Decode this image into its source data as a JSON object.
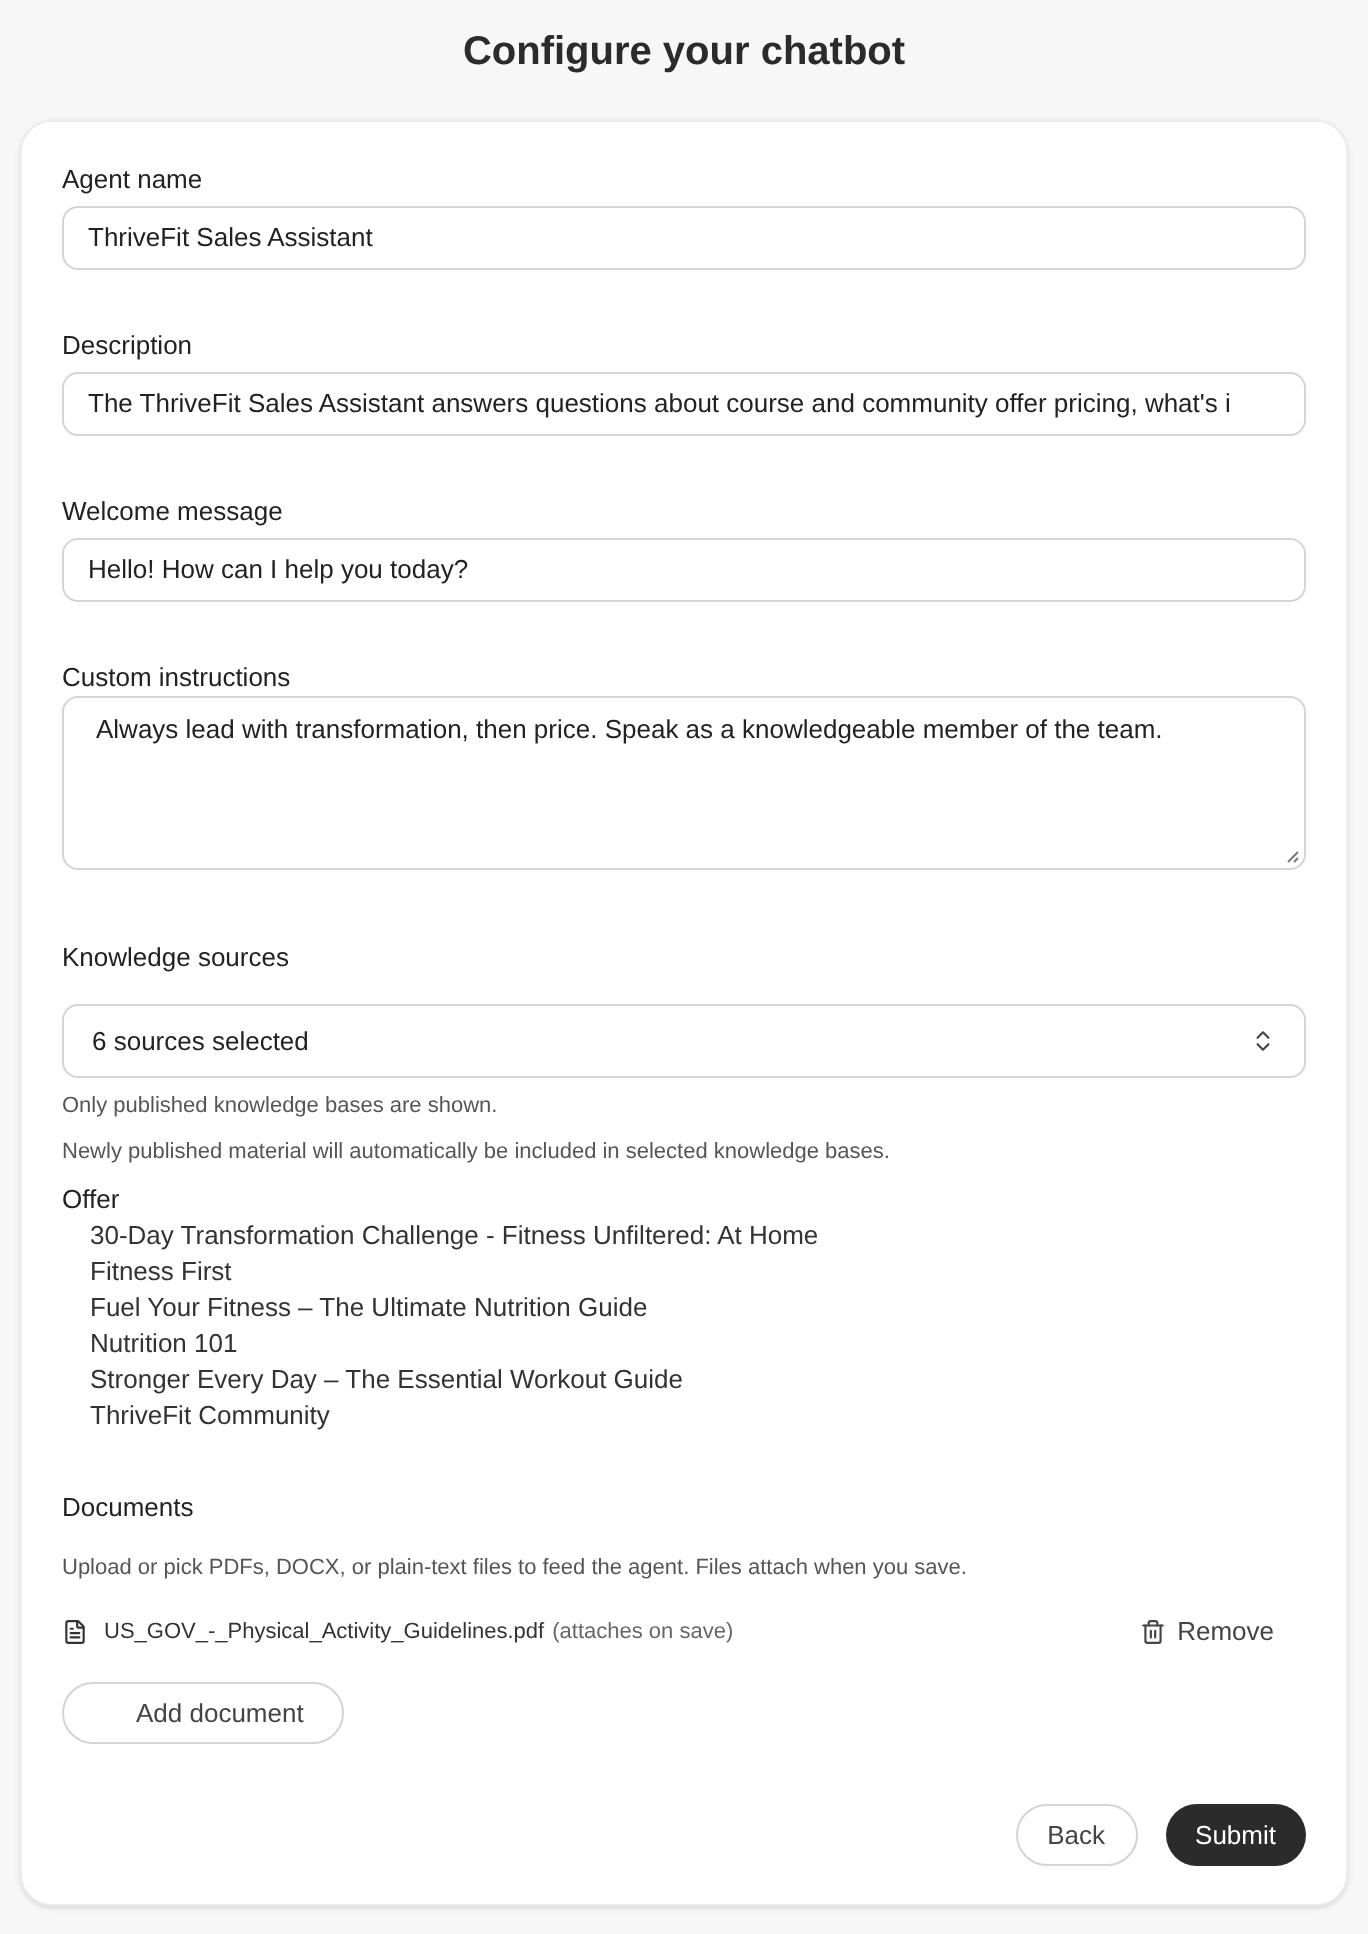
{
  "page": {
    "title": "Configure your chatbot"
  },
  "fields": [
    {
      "kind": "input",
      "label": "Agent name",
      "value": "ThriveFit Sales Assistant"
    },
    {
      "kind": "input",
      "label": "Description",
      "value": "The ThriveFit Sales Assistant answers questions about course and community offer pricing, what's i"
    },
    {
      "kind": "input",
      "label": "Welcome message",
      "value": "Hello! How can I help you today?"
    },
    {
      "kind": "textarea",
      "label": "Custom instructions",
      "value": "Always lead with transformation, then price. Speak as a knowledgeable member of the team."
    }
  ],
  "knowledge_sources": {
    "label": "Knowledge sources",
    "select": {
      "value": "6 sources selected"
    },
    "hints": [
      "Only published knowledge bases are shown.",
      "Newly published material will automatically be included in selected knowledge bases."
    ],
    "groups": [
      {
        "name": "Offer",
        "children": [
          "30-Day Transformation Challenge - Fitness Unfiltered: At Home",
          "Fitness First",
          "Fuel Your Fitness – The Ultimate Nutrition Guide",
          "Nutrition 101",
          "Stronger Every Day – The Essential Workout Guide",
          "ThriveFit Community"
        ]
      }
    ]
  },
  "documents": {
    "label": "Documents",
    "hint": "Upload or pick PDFs, DOCX, or plain-text files to feed the agent. Files attach when you save.",
    "files": [
      {
        "name": "US_GOV_-_Physical_Activity_Guidelines.pdf",
        "note": "(attaches on save)",
        "action": "Remove"
      }
    ],
    "add_button": "Add document"
  },
  "actions": [
    {
      "kind": "secondary",
      "label": "Back"
    },
    {
      "kind": "primary",
      "label": "Submit"
    }
  ]
}
